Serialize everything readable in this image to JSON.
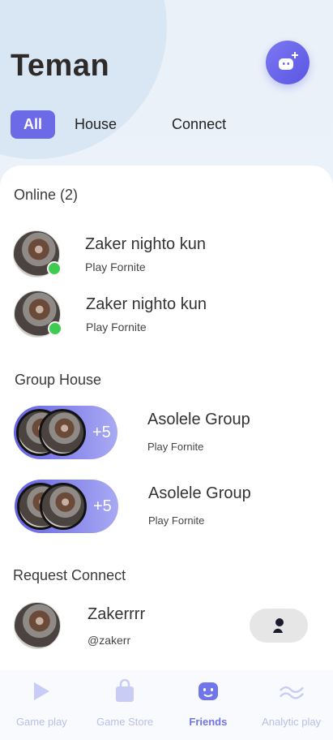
{
  "header": {
    "title": "Teman"
  },
  "tabs": [
    {
      "label": "All",
      "active": true
    },
    {
      "label": "House",
      "active": false
    },
    {
      "label": "Connect",
      "active": false
    }
  ],
  "online": {
    "title": "Online (2)",
    "friends": [
      {
        "name": "Zaker nighto kun",
        "status": "Play Fornite"
      },
      {
        "name": "Zaker nighto kun",
        "status": "Play Fornite"
      }
    ]
  },
  "groups": {
    "title": "Group House",
    "items": [
      {
        "name": "Asolele Group",
        "status": "Play Fornite",
        "extra": "+5"
      },
      {
        "name": "Asolele Group",
        "status": "Play Fornite",
        "extra": "+5"
      }
    ]
  },
  "requests": {
    "title": "Request Connect",
    "items": [
      {
        "name": "Zakerrrr",
        "handle": "@zakerr"
      }
    ]
  },
  "nav": [
    {
      "label": "Game play",
      "icon": "play-icon"
    },
    {
      "label": "Game Store",
      "icon": "bag-icon"
    },
    {
      "label": "Friends",
      "icon": "friends-icon",
      "active": true
    },
    {
      "label": "Analytic play",
      "icon": "wave-icon"
    }
  ],
  "colors": {
    "accent": "#6d6ae8",
    "online": "#3ecb4f"
  }
}
